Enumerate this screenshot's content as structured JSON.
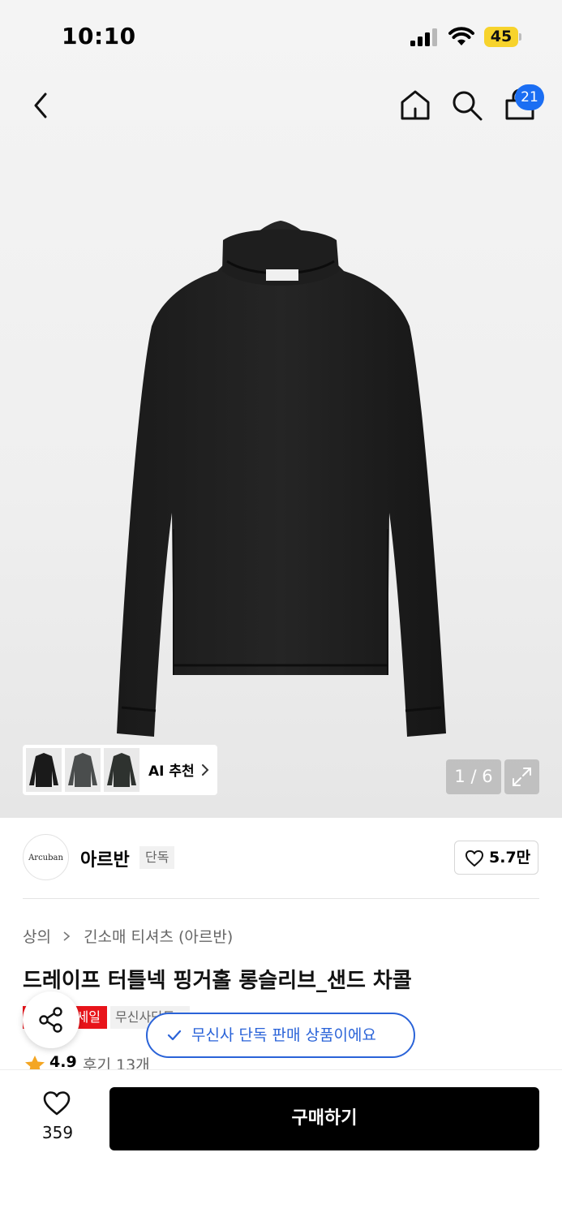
{
  "status_bar": {
    "time": "10:10",
    "battery": "45"
  },
  "header": {
    "cart_count": "21"
  },
  "gallery": {
    "ai_recommend_label": "AI 추천",
    "page_indicator": "1 / 6"
  },
  "brand": {
    "logo_text": "Arcuban",
    "name": "아르반",
    "tag": "단독",
    "like_count": "5.7만"
  },
  "breadcrumb": {
    "category": "상의",
    "subcategory": "긴소매 티셔츠 (아르반)"
  },
  "product": {
    "title": "드레이프 터틀넥 핑거홀 롱슬리브_샌드 차콜",
    "tag_sale": "세일",
    "tag_exclusive": "무신사단독",
    "rating": "4.9",
    "review_count": "후기 13개"
  },
  "toast": {
    "message": "무신사 단독 판매 상품이에요"
  },
  "bottom": {
    "like_count": "359",
    "buy_label": "구매하기"
  },
  "colors": {
    "accent_blue": "#1b6ef3",
    "sale_red": "#e8141a",
    "toast_blue": "#2a63d8",
    "star": "#f4a623"
  }
}
